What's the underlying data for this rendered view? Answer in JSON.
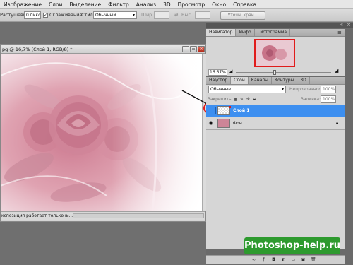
{
  "menu": [
    "Изображение",
    "Слои",
    "Выделение",
    "Фильтр",
    "Анализ",
    "3D",
    "Просмотр",
    "Окно",
    "Справка"
  ],
  "options": {
    "feather_label": "Растушевка:",
    "feather_value": "0 пикс.",
    "antialias_label": "Сглаживание",
    "style_label": "Стиль:",
    "style_value": "Обычный",
    "width_label": "Шир.:",
    "height_label": "Выс.:",
    "refine_button": "Уточн. край..."
  },
  "document": {
    "title": "pg @ 16,7% (Слой 1, RGB/8) *",
    "status": "кспозиция работает только в ..."
  },
  "navigator": {
    "tabs": [
      "Навигатор",
      "Инфо",
      "Гистограмма"
    ],
    "zoom": "16.67%"
  },
  "layers_panel": {
    "tabs": [
      "Наl/стор",
      "Слои",
      "Каналы",
      "Контуры",
      "3D"
    ],
    "blend_mode": "Обычные",
    "opacity_label": "Непрозрачность:",
    "opacity_value": "100%",
    "lock_label": "Закрепить:",
    "fill_label": "Заливка:",
    "fill_value": "100%",
    "layers": [
      {
        "name": "Слой 1",
        "selected": true
      },
      {
        "name": "Фон",
        "selected": false
      }
    ]
  },
  "watermark": "Photoshop-help.ru",
  "colors": {
    "selection_blue": "#3d8ff0",
    "annotation_red": "#e01b1b",
    "watermark_green": "#2d9a2e"
  }
}
